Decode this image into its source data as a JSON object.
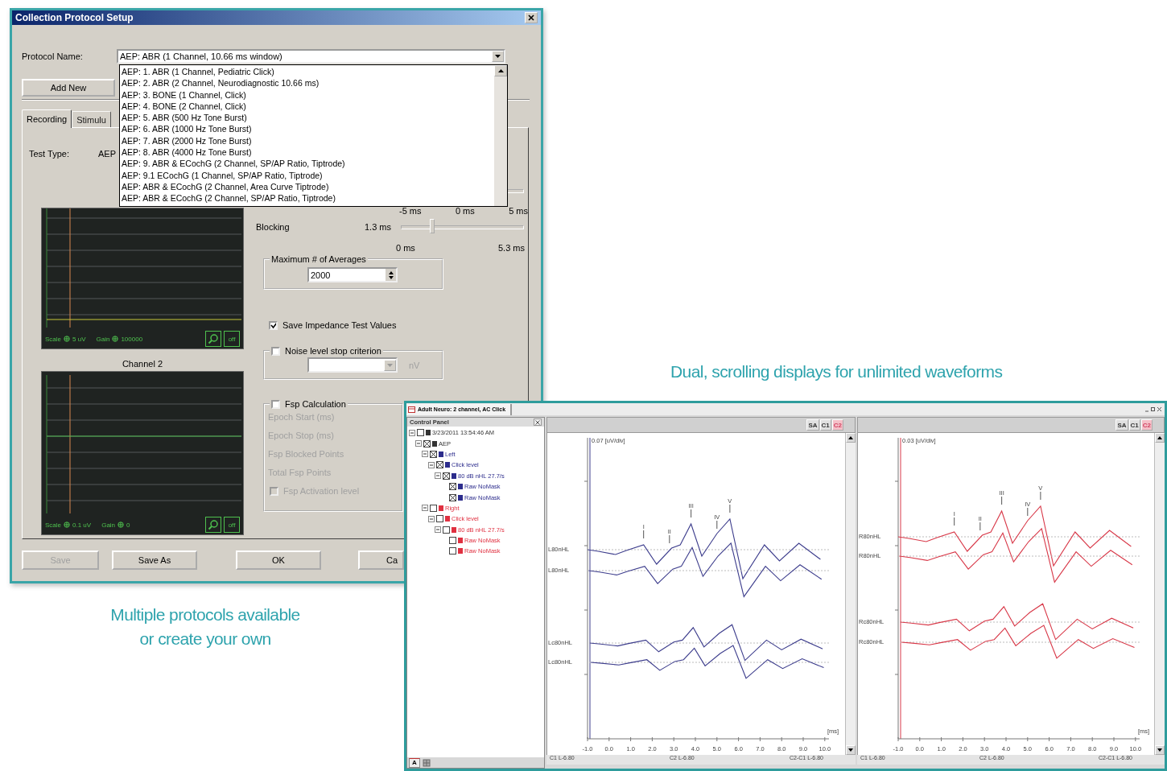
{
  "setup_dialog": {
    "title": "Collection Protocol Setup",
    "protocol_label": "Protocol Name:",
    "protocol_value": "AEP: ABR (1 Channel, 10.66 ms window)",
    "protocol_options": [
      {
        "label": "AEP: 1. ABR (1 Channel, Pediatric Click)",
        "selected": false
      },
      {
        "label": "AEP: 2. ABR (2 Channel, Neurodiagnostic 10.66 ms)",
        "selected": false
      },
      {
        "label": "AEP: 3. BONE (1 Channel, Click)",
        "selected": false
      },
      {
        "label": "AEP: 4. BONE (2 Channel, Click)",
        "selected": false
      },
      {
        "label": "AEP: 5. ABR (500 Hz Tone Burst)",
        "selected": false
      },
      {
        "label": "AEP: 6. ABR (1000 Hz Tone Burst)",
        "selected": false
      },
      {
        "label": "AEP: 7. ABR (2000 Hz Tone Burst)",
        "selected": false
      },
      {
        "label": "AEP: 8. ABR (4000 Hz Tone Burst)",
        "selected": false
      },
      {
        "label": "AEP: 9. ABR & ECochG (2 Channel, SP/AP Ratio, Tiptrode)",
        "selected": false
      },
      {
        "label": "AEP: 9.1 ECochG (1 Channel, SP/AP Ratio, Tiptrode)",
        "selected": false
      },
      {
        "label": "AEP: ABR & ECochG (2 Channel, Area Curve Tiptrode)",
        "selected": false
      },
      {
        "label": "AEP: ABR & ECochG (2 Channel, SP/AP Ratio, Tiptrode)",
        "selected": false
      }
    ],
    "add_new": "Add New",
    "tabs": [
      {
        "label": "Recording",
        "selected": true
      },
      {
        "label": "Stimulu",
        "selected": false
      }
    ],
    "test_type_label": "Test Type:",
    "test_type_value": "AEP",
    "channels": [
      {
        "scale_label": "Scale",
        "scale": "5 uV",
        "gain_label": "Gain",
        "gain": "100000",
        "off": "off"
      },
      {
        "title": "Channel 2",
        "scale_label": "Scale",
        "scale": "0.1 uV",
        "gain_label": "Gain",
        "gain": "0",
        "off": "off"
      }
    ],
    "window_slider": {
      "tick_labels": [
        "-5 ms",
        "0 ms",
        "5 ms"
      ]
    },
    "blocking": {
      "label": "Blocking",
      "value": "1.3 ms",
      "level": 0.25,
      "tick_labels": [
        "0 ms",
        "5.3 ms"
      ]
    },
    "averages": {
      "label": "Maximum # of Averages",
      "value": "2000"
    },
    "save_impedance": {
      "label": "Save Impedance Test Values",
      "checked": true
    },
    "noise_stop": {
      "label": "Noise level stop criterion",
      "checked": false,
      "unit": "nV"
    },
    "fsp": {
      "label": "Fsp Calculation",
      "checked": false,
      "fields": [
        "Epoch Start (ms)",
        "Epoch Stop (ms)",
        "Fsp Blocked Points",
        "Total Fsp Points"
      ],
      "activation": {
        "label": "Fsp Activation level",
        "checked": false
      }
    },
    "buttons": [
      {
        "label": "Save",
        "disabled": true
      },
      {
        "label": "Save As",
        "disabled": false
      },
      {
        "label": "OK",
        "disabled": false
      },
      {
        "label": "Ca",
        "disabled": false
      }
    ]
  },
  "review_window": {
    "title": "Adult Neuro: 2 channel, AC Click",
    "control_panel": {
      "title": "Control Panel",
      "bottom_tab": "A",
      "tree": [
        {
          "label": "3/23/2011 13:54:46 AM",
          "color": "#333333",
          "checked": false,
          "expanded": true,
          "children": [
            {
              "label": "AEP",
              "color": "#333333",
              "checked": true,
              "expanded": true,
              "children": [
                {
                  "label": "Left",
                  "color": "#2c2c8c",
                  "checked": true,
                  "expanded": true,
                  "children": [
                    {
                      "label": "Click level",
                      "color": "#2c2c8c",
                      "checked": true,
                      "expanded": true,
                      "children": [
                        {
                          "label": "80 dB nHL 27.7/s",
                          "color": "#2c2c8c",
                          "checked": true,
                          "expanded": true,
                          "children": [
                            {
                              "label": "Raw NoMask",
                              "color": "#2c2c8c",
                              "checked": true
                            },
                            {
                              "label": "Raw NoMask",
                              "color": "#2c2c8c",
                              "checked": true
                            }
                          ]
                        }
                      ]
                    }
                  ]
                },
                {
                  "label": "Right",
                  "color": "#e03040",
                  "checked": false,
                  "expanded": true,
                  "children": [
                    {
                      "label": "Click level",
                      "color": "#e03040",
                      "checked": false,
                      "expanded": true,
                      "children": [
                        {
                          "label": "80 dB nHL 27.7/s",
                          "color": "#e03040",
                          "checked": false,
                          "expanded": true,
                          "children": [
                            {
                              "label": "Raw NoMask",
                              "color": "#e03040",
                              "checked": false
                            },
                            {
                              "label": "Raw NoMask",
                              "color": "#e03040",
                              "checked": false
                            }
                          ]
                        }
                      ]
                    }
                  ]
                }
              ]
            }
          ]
        }
      ]
    },
    "panels": [
      {
        "color": "#3c3c8c",
        "buttons": [
          "SA",
          "C1",
          "C2"
        ],
        "y_label": "0.07 [uV/div]",
        "trace_labels": [
          "L80nHL",
          "L80nHL",
          "Lc80nHL",
          "Lc80nHL"
        ],
        "peak_labels": [
          "I",
          "II",
          "III",
          "IV",
          "V"
        ],
        "x_ticks": [
          "-1.0",
          "0.0",
          "1.0",
          "2.0",
          "3.0",
          "4.0",
          "5.0",
          "6.0",
          "7.0",
          "8.0",
          "9.0",
          "10.0"
        ],
        "x_unit": "[ms]",
        "status": [
          "C1 L-6.80",
          "C2 L-6.80",
          "C2-C1 L-6.80"
        ]
      },
      {
        "color": "#d83848",
        "buttons": [
          "SA",
          "C1",
          "C2"
        ],
        "y_label": "0.03 [uV/div]",
        "trace_labels": [
          "R80nHL",
          "R80nHL",
          "Rc80nHL",
          "Rc80nHL"
        ],
        "peak_labels": [
          "I",
          "II",
          "III",
          "IV",
          "V"
        ],
        "x_ticks": [
          "-1.0",
          "0.0",
          "1.0",
          "2.0",
          "3.0",
          "4.0",
          "5.0",
          "6.0",
          "7.0",
          "8.0",
          "9.0",
          "10.0"
        ],
        "x_unit": "[ms]",
        "status": [
          "C1 L-6.80",
          "C2 L-6.80",
          "C2-C1 L-6.80"
        ]
      }
    ]
  },
  "captions": {
    "right": "Dual, scrolling displays for unlimited waveforms",
    "left": [
      "Multiple protocols available",
      "or create your own"
    ]
  }
}
